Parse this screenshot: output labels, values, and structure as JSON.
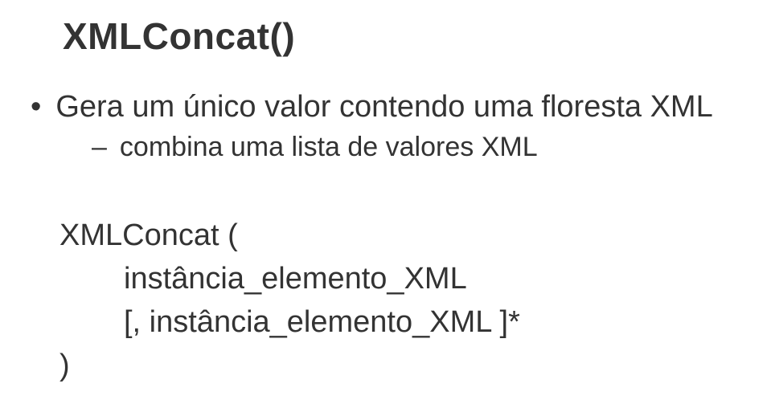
{
  "title": "XMLConcat()",
  "bullet": {
    "text": "Gera um único valor contendo uma floresta XML",
    "sub": "combina uma lista de valores XML"
  },
  "syntax": {
    "open": "XMLConcat (",
    "arg1": "instância_elemento_XML",
    "arg2": "[, instância_elemento_XML ]*",
    "close": ")"
  }
}
